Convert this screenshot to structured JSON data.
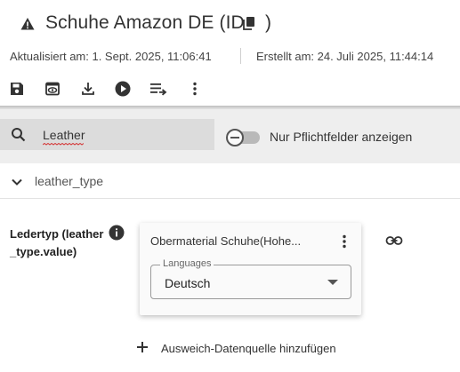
{
  "header": {
    "title": "Schuhe Amazon DE (ID",
    "title_close": ")",
    "warning_icon": "warning-icon",
    "copy_icon": "copy-icon"
  },
  "meta": {
    "updated": "Aktualisiert am: 1. Sept. 2025, 11:06:41",
    "created": "Erstellt am: 24. Juli 2025, 11:44:14"
  },
  "toolbar": {
    "icons": [
      "save-icon",
      "preview-icon",
      "download-icon",
      "play-icon",
      "playlist-arrow-icon",
      "more-vert-icon"
    ]
  },
  "filter": {
    "search_value": "Leather",
    "toggle_label": "Nur Pflichtfelder anzeigen",
    "toggle_on": false
  },
  "section": {
    "label": "leather_type",
    "expanded": true
  },
  "field": {
    "label": "Ledertyp (leather_type.value)"
  },
  "card": {
    "title": "Obermaterial Schuhe(Hohe...",
    "select_legend": "Languages",
    "select_value": "Deutsch"
  },
  "add_fallback": {
    "label": "Ausweich-Datenquelle hinzufügen"
  },
  "colors": {
    "text": "#333333",
    "filter_bg": "#eeeeee",
    "search_bg": "#dcdcdc",
    "card_bg": "#fafafa",
    "spellcheck": "#d32f2f"
  }
}
